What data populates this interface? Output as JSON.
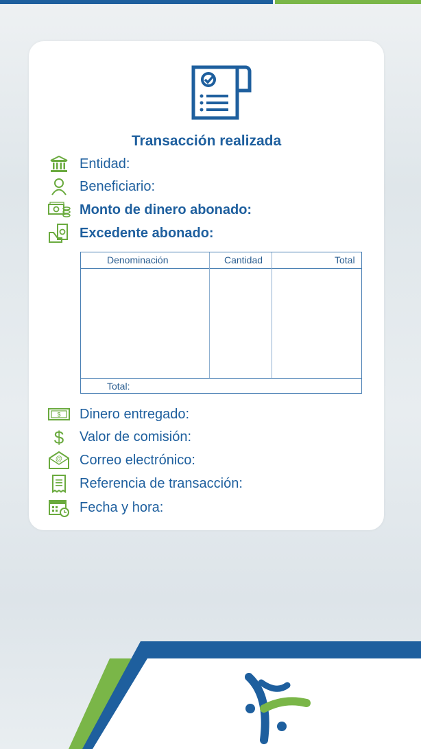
{
  "receipt": {
    "title": "Transacción realizada",
    "fields_top": [
      {
        "icon": "bank-icon",
        "label": "Entidad:",
        "bold": false
      },
      {
        "icon": "user-icon",
        "label": "Beneficiario:",
        "bold": false
      },
      {
        "icon": "cash-coins-icon",
        "label": "Monto de dinero abonado:",
        "bold": true
      },
      {
        "icon": "cash-hand-icon",
        "label": "Excedente abonado:",
        "bold": true
      }
    ],
    "table": {
      "headers": [
        "Denominación",
        "Cantidad",
        "Total"
      ],
      "footer_label": "Total:"
    },
    "fields_bottom": [
      {
        "icon": "banknote-icon",
        "label": "Dinero entregado:"
      },
      {
        "icon": "dollar-icon",
        "label": "Valor de comisión:"
      },
      {
        "icon": "email-icon",
        "label": "Correo electrónico:"
      },
      {
        "icon": "receipt-icon",
        "label": "Referencia de transacción:"
      },
      {
        "icon": "calendar-clock-icon",
        "label": "Fecha y hora:"
      }
    ]
  },
  "colors": {
    "primary_blue": "#1e5f9e",
    "accent_green": "#7ab648"
  }
}
